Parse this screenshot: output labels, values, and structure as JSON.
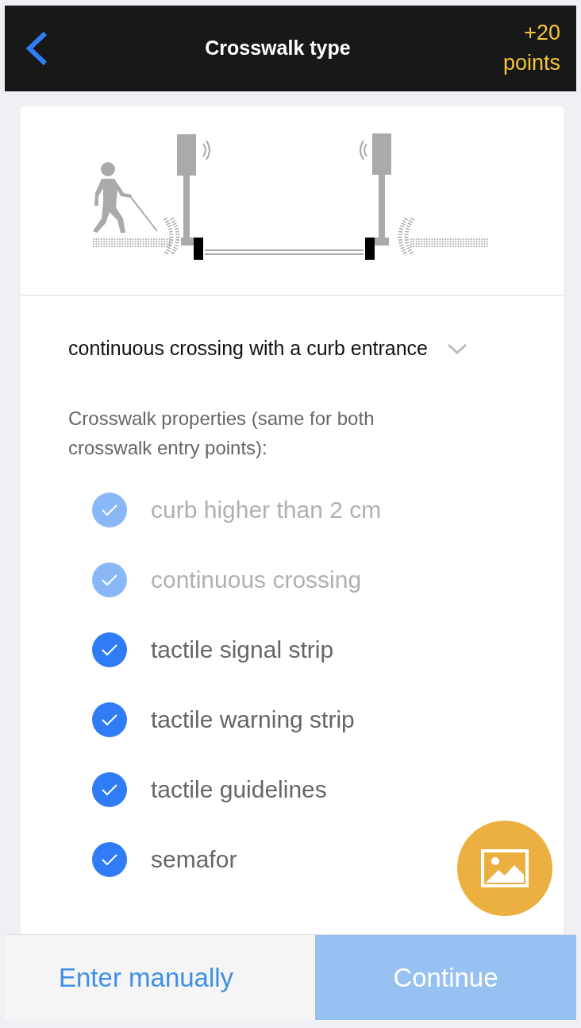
{
  "header": {
    "title": "Crosswalk type",
    "points_line1": "+20",
    "points_line2": "points"
  },
  "dropdown": {
    "value": "continuous crossing with a curb entrance"
  },
  "properties_label": "Crosswalk properties (same for both crosswalk entry points):",
  "properties": [
    {
      "label": "curb higher than 2 cm",
      "checked": true,
      "disabled": true
    },
    {
      "label": "continuous crossing",
      "checked": true,
      "disabled": true
    },
    {
      "label": "tactile signal strip",
      "checked": true,
      "disabled": false
    },
    {
      "label": "tactile warning strip",
      "checked": true,
      "disabled": false
    },
    {
      "label": "tactile guidelines",
      "checked": true,
      "disabled": false
    },
    {
      "label": "semafor",
      "checked": true,
      "disabled": false
    }
  ],
  "footer": {
    "secondary": "Enter manually",
    "primary": "Continue",
    "primary_disabled": true
  }
}
